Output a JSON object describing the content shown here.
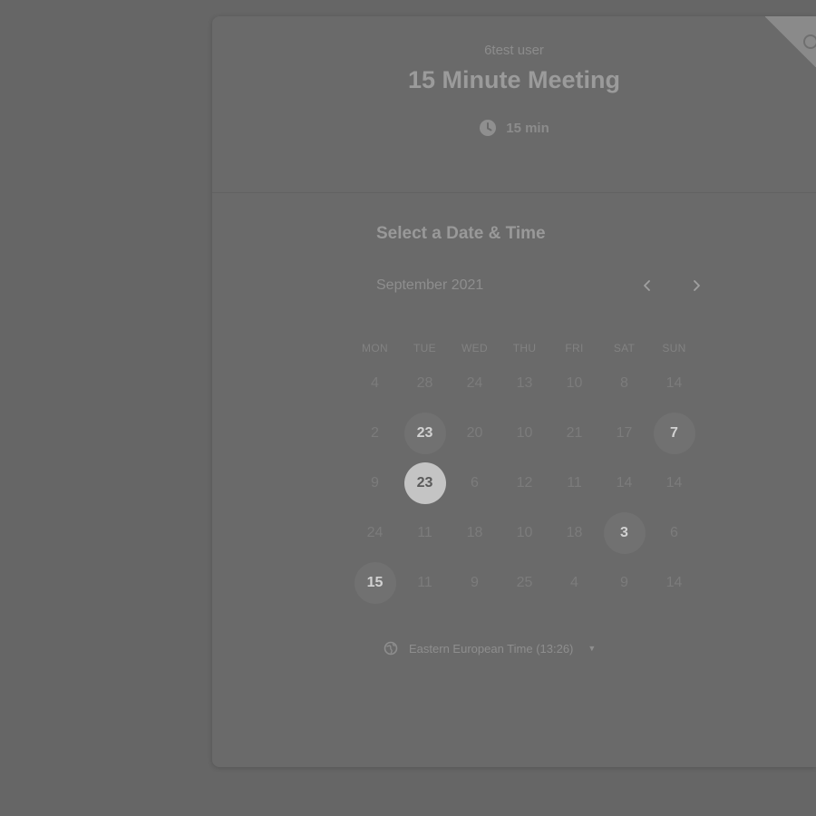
{
  "header": {
    "owner": "6test user",
    "title": "15 Minute Meeting",
    "duration": "15 min"
  },
  "calendar": {
    "heading": "Select a Date & Time",
    "month": "September 2021",
    "prev_icon": "chevron-left-icon",
    "next_icon": "chevron-right-icon",
    "weekdays": [
      "MON",
      "TUE",
      "WED",
      "THU",
      "FRI",
      "SAT",
      "SUN"
    ],
    "days": [
      {
        "label": "4",
        "state": "disabled"
      },
      {
        "label": "28",
        "state": "disabled"
      },
      {
        "label": "24",
        "state": "disabled"
      },
      {
        "label": "13",
        "state": "disabled"
      },
      {
        "label": "10",
        "state": "disabled"
      },
      {
        "label": "8",
        "state": "disabled"
      },
      {
        "label": "14",
        "state": "disabled"
      },
      {
        "label": "2",
        "state": "disabled"
      },
      {
        "label": "23",
        "state": "available"
      },
      {
        "label": "20",
        "state": "disabled"
      },
      {
        "label": "10",
        "state": "disabled"
      },
      {
        "label": "21",
        "state": "disabled"
      },
      {
        "label": "17",
        "state": "disabled"
      },
      {
        "label": "7",
        "state": "available"
      },
      {
        "label": "9",
        "state": "disabled"
      },
      {
        "label": "23",
        "state": "selected"
      },
      {
        "label": "6",
        "state": "disabled"
      },
      {
        "label": "12",
        "state": "disabled"
      },
      {
        "label": "11",
        "state": "disabled"
      },
      {
        "label": "14",
        "state": "disabled"
      },
      {
        "label": "14",
        "state": "disabled"
      },
      {
        "label": "24",
        "state": "disabled"
      },
      {
        "label": "11",
        "state": "disabled"
      },
      {
        "label": "18",
        "state": "disabled"
      },
      {
        "label": "10",
        "state": "disabled"
      },
      {
        "label": "18",
        "state": "disabled"
      },
      {
        "label": "3",
        "state": "available"
      },
      {
        "label": "6",
        "state": "disabled"
      },
      {
        "label": "15",
        "state": "available"
      },
      {
        "label": "11",
        "state": "disabled"
      },
      {
        "label": "9",
        "state": "disabled"
      },
      {
        "label": "25",
        "state": "disabled"
      },
      {
        "label": "4",
        "state": "disabled"
      },
      {
        "label": "9",
        "state": "disabled"
      },
      {
        "label": "14",
        "state": "disabled"
      }
    ]
  },
  "timezone": {
    "label": "Eastern European Time (13:26)",
    "icon": "globe-icon",
    "caret_icon": "caret-down-icon"
  },
  "colors": {
    "overlay": "#666666",
    "selected_day": "#c4c4c4"
  }
}
